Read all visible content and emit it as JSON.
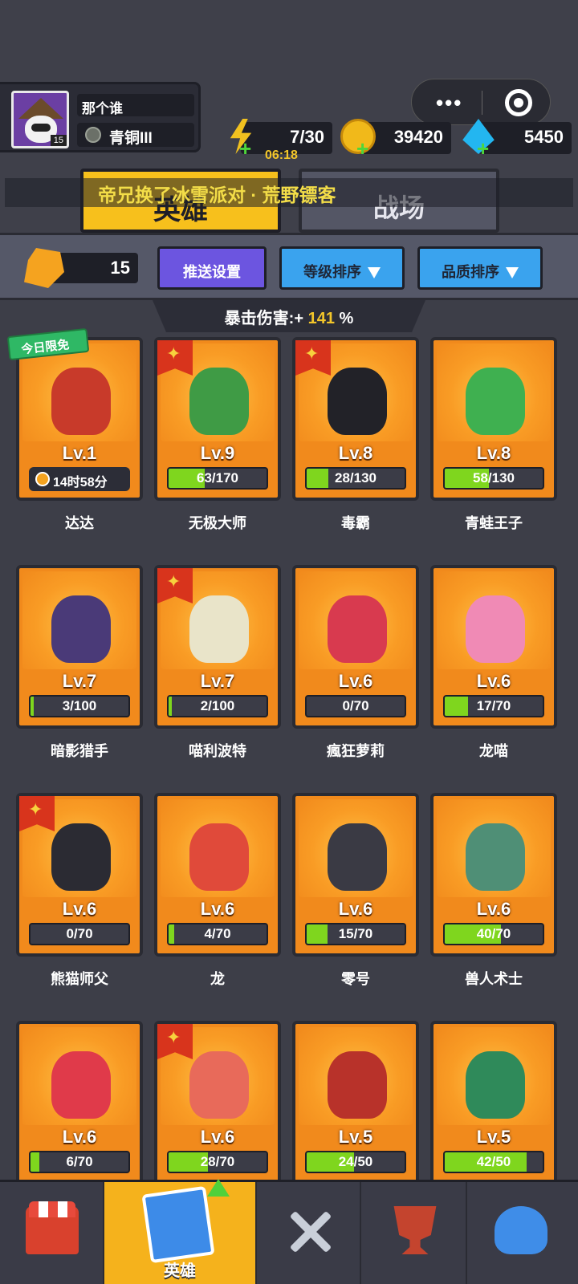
{
  "player": {
    "name": "那个谁",
    "level": "15",
    "rank": "青铜III"
  },
  "resources": {
    "energy": "7/30",
    "energy_timer": "06:18",
    "gold": "39420",
    "gems": "5450"
  },
  "announcement": "帝兄换了冰雪派对 · 荒野镖客",
  "tabs": {
    "hero": "英雄",
    "battle": "战场"
  },
  "toolbar": {
    "fragments": "15",
    "push_settings": "推送设置",
    "level_sort": "等级排序",
    "quality_sort": "品质排序"
  },
  "crit": {
    "label": "暴击伤害:+",
    "value": "141",
    "unit": "%"
  },
  "free_badge": "今日限免",
  "heroes": [
    {
      "name": "达达",
      "level": "Lv.1",
      "timer": "14时58分",
      "color": "#c83a2a"
    },
    {
      "name": "无极大师",
      "level": "Lv.9",
      "progress": "63/170",
      "fill": 0.37,
      "starred": true,
      "color": "#3f9b45"
    },
    {
      "name": "毒霸",
      "level": "Lv.8",
      "progress": "28/130",
      "fill": 0.22,
      "starred": true,
      "color": "#222228"
    },
    {
      "name": "青蛙王子",
      "level": "Lv.8",
      "progress": "58/130",
      "fill": 0.45,
      "color": "#3fb050"
    },
    {
      "name": "暗影猎手",
      "level": "Lv.7",
      "progress": "3/100",
      "fill": 0.03,
      "color": "#4a3a78"
    },
    {
      "name": "喵利波特",
      "level": "Lv.7",
      "progress": "2/100",
      "fill": 0.02,
      "starred": true,
      "color": "#e9e4c9"
    },
    {
      "name": "瘋狂萝莉",
      "level": "Lv.6",
      "progress": "0/70",
      "fill": 0,
      "color": "#d83a4f"
    },
    {
      "name": "龙喵",
      "level": "Lv.6",
      "progress": "17/70",
      "fill": 0.24,
      "color": "#f08ab5"
    },
    {
      "name": "熊猫师父",
      "level": "Lv.6",
      "progress": "0/70",
      "fill": 0,
      "starred": true,
      "color": "#2b2b33"
    },
    {
      "name": "龙",
      "level": "Lv.6",
      "progress": "4/70",
      "fill": 0.06,
      "color": "#e04a3a"
    },
    {
      "name": "零号",
      "level": "Lv.6",
      "progress": "15/70",
      "fill": 0.21,
      "color": "#3a3a44"
    },
    {
      "name": "兽人术士",
      "level": "Lv.6",
      "progress": "40/70",
      "fill": 0.57,
      "color": "#4f8f76"
    },
    {
      "name": "",
      "level": "Lv.6",
      "progress": "6/70",
      "fill": 0.09,
      "color": "#e03a4a"
    },
    {
      "name": "",
      "level": "Lv.6",
      "progress": "28/70",
      "fill": 0.4,
      "starred": true,
      "color": "#e86a5a"
    },
    {
      "name": "",
      "level": "Lv.5",
      "progress": "24/50",
      "fill": 0.48,
      "color": "#b8322a"
    },
    {
      "name": "",
      "level": "Lv.5",
      "progress": "42/50",
      "fill": 0.84,
      "color": "#2f8a5a"
    }
  ],
  "nav": {
    "hero_label": "英雄"
  },
  "icons": [
    "shop-icon",
    "hero-cards-icon",
    "battle-swords-icon",
    "trophy-icon",
    "friends-icon"
  ]
}
